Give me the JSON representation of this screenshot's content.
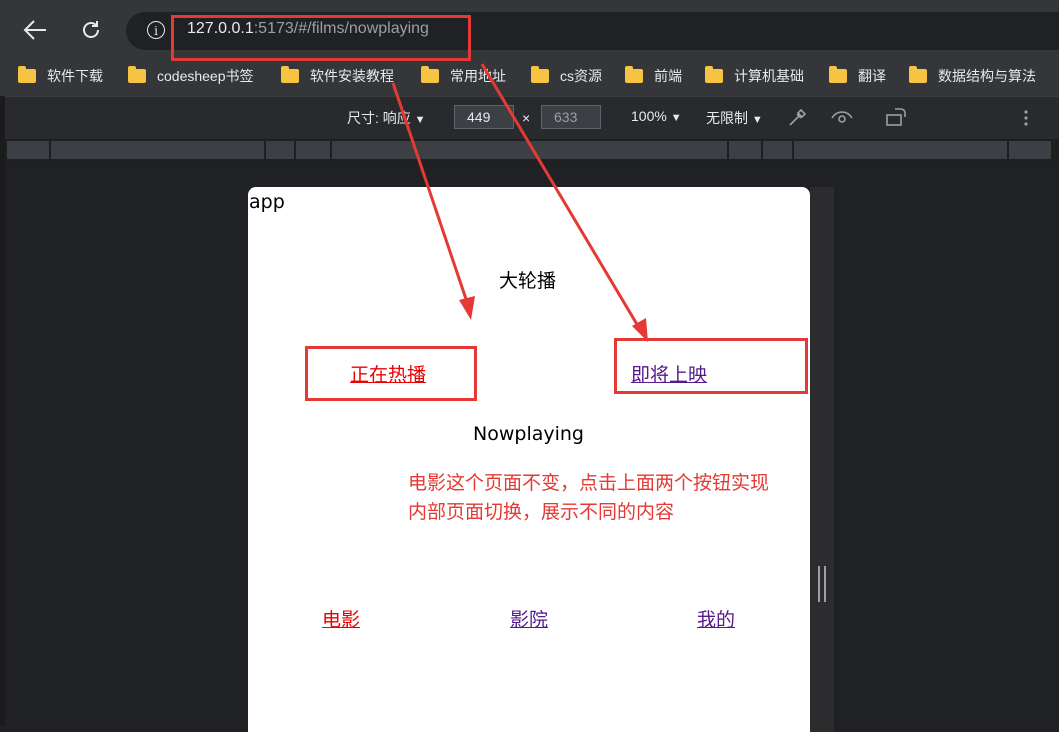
{
  "browser": {
    "url_host": "127.0.0.1",
    "url_rest": ":5173/#/films/nowplaying",
    "bookmarks": [
      "软件下载",
      "codesheep书签",
      "软件安装教程",
      "常用地址",
      "cs资源",
      "前端",
      "计算机基础",
      "翻译",
      "数据结构与算法"
    ]
  },
  "devtools": {
    "size_label": "尺寸: 响应",
    "width": "449",
    "times": "×",
    "height": "633",
    "zoom": "100%",
    "throttle": "无限制"
  },
  "page": {
    "app_label": "app",
    "carousel": "大轮播",
    "tab_nowplaying": "正在热播",
    "tab_comingsoon": "即将上映",
    "content": "Nowplaying",
    "tabbar": [
      "电影",
      "影院",
      "我的"
    ]
  },
  "annotation": {
    "line1": "电影这个页面不变，点击上面两个按钮实现",
    "line2": "内部页面切换，展示不同的内容"
  },
  "colors": {
    "active_link": "#ee0000",
    "visited_link": "#551a8b",
    "annotation": "#e53935"
  }
}
